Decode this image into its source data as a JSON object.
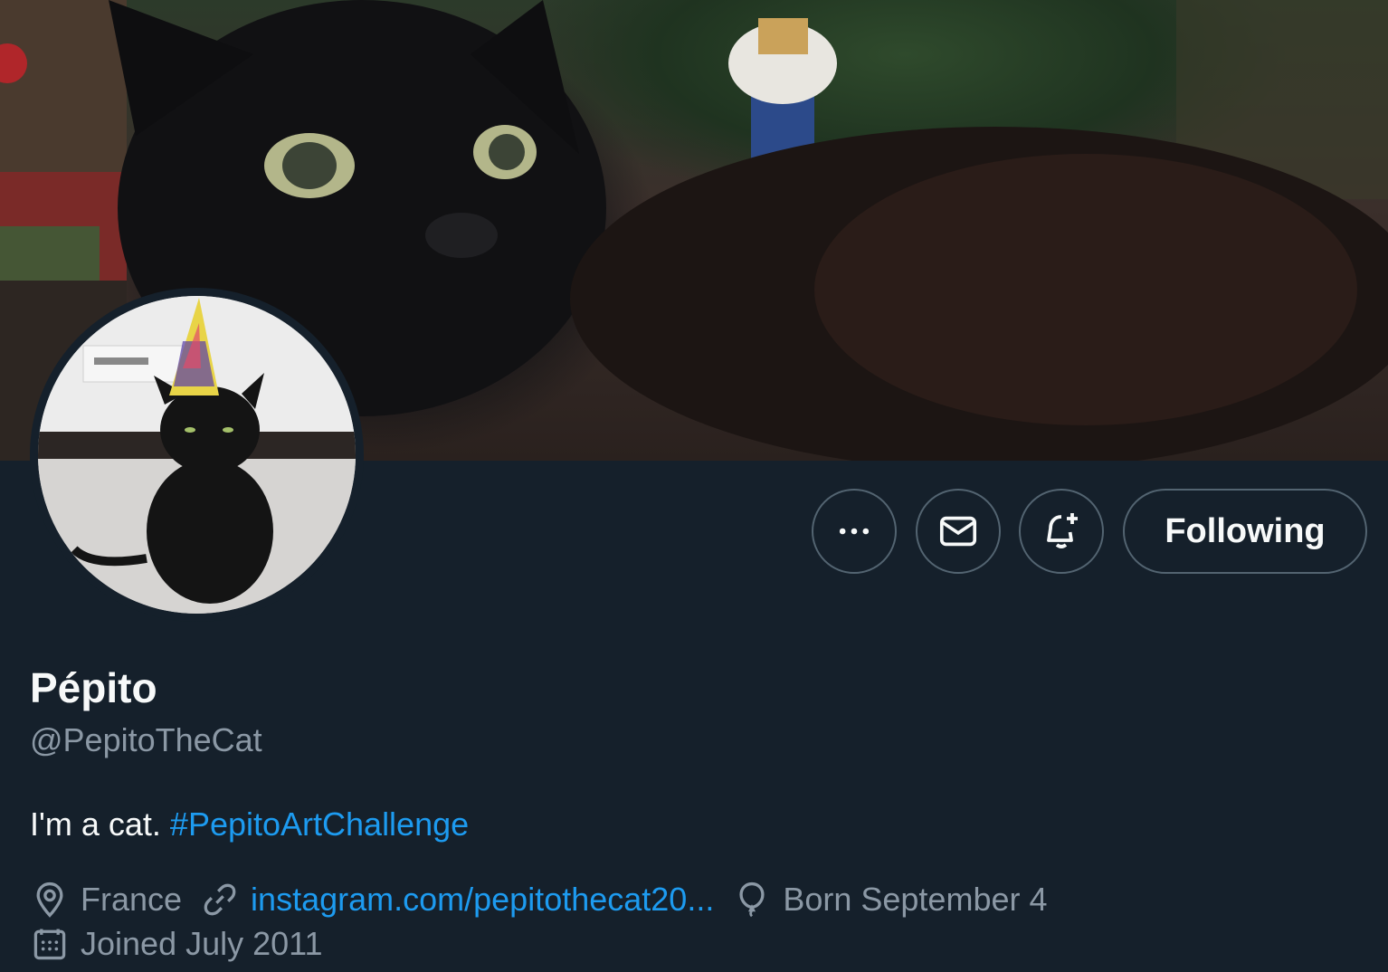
{
  "banner": {
    "description_icon": "banner-photo"
  },
  "avatar": {
    "icon": "avatar-photo"
  },
  "actions": {
    "more_icon": "more-dots-icon",
    "message_icon": "mail-icon",
    "notify_icon": "bell-plus-icon",
    "follow_label": "Following"
  },
  "profile": {
    "name": "Pépito",
    "handle": "@PepitoTheCat",
    "bio_text": "I'm a cat. ",
    "bio_hashtag": "#PepitoArtChallenge"
  },
  "meta": {
    "location": "France",
    "link": "instagram.com/pepitothecat20...",
    "birthday": "Born September 4",
    "joined": "Joined July 2011"
  },
  "colors": {
    "background": "#15202b",
    "accent": "#1d9bf0",
    "secondary_text": "#8b98a5",
    "border": "#536471"
  }
}
